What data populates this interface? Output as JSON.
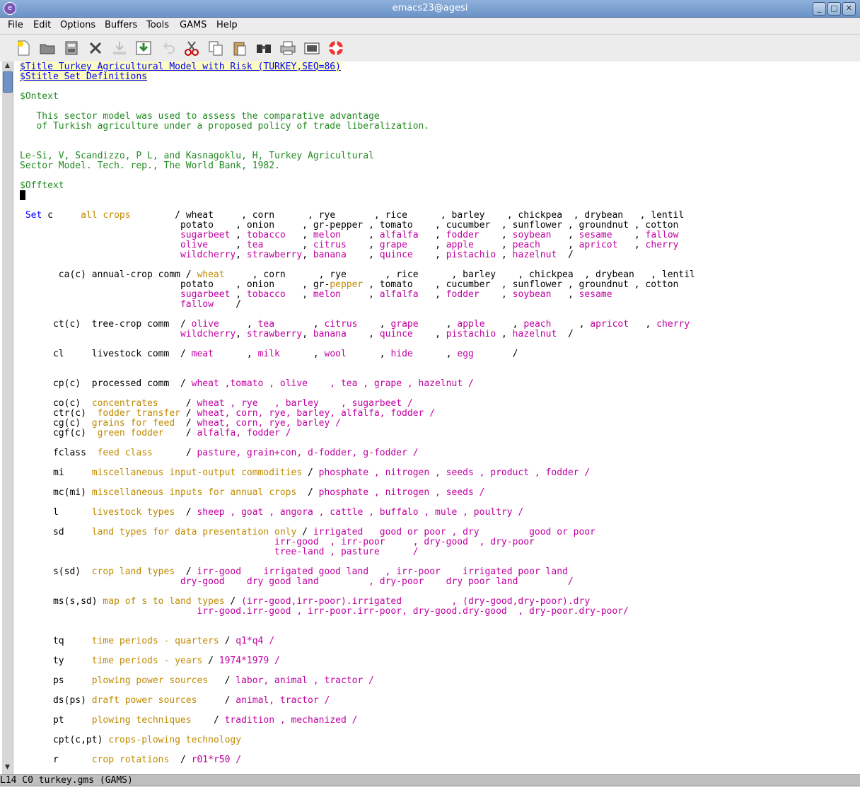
{
  "window": {
    "title": "emacs23@agesi"
  },
  "menu": [
    "File",
    "Edit",
    "Options",
    "Buffers",
    "Tools",
    "GAMS",
    "Help"
  ],
  "toolbar": [
    "new-file",
    "open",
    "dired",
    "close",
    "save",
    "save-as",
    "undo",
    "cut",
    "copy",
    "paste",
    "search",
    "print",
    "preferences",
    "help"
  ],
  "modeline": "L14 C0 turkey.gms (GAMS)",
  "lines": [
    [
      [
        "$Title Turkey Agricultural Model with Risk (TURKEY,SEQ=86)",
        "dir"
      ]
    ],
    [
      [
        "$Stitle Set Definitions",
        "dir"
      ]
    ],
    [],
    [
      [
        "$Ontext",
        "grn"
      ]
    ],
    [],
    [
      [
        "   This sector model was used to assess the comparative advantage",
        "grn"
      ]
    ],
    [
      [
        "   of Turkish agriculture under a proposed policy of trade liberalization.",
        "grn"
      ]
    ],
    [],
    [],
    [
      [
        "Le-Si, V, Scandizzo, P L, and Kasnagoklu, H, Turkey Agricultural",
        "grn"
      ]
    ],
    [
      [
        "Sector Model. Tech. rep., The World Bank, 1982.",
        "grn"
      ]
    ],
    [],
    [
      [
        "$Offtext",
        "grn"
      ]
    ],
    [],
    [],
    [
      [
        " Set",
        "kw"
      ],
      [
        " c     ",
        ""
      ],
      [
        "all crops",
        "org"
      ],
      [
        "        / wheat     , corn      , rye       , rice      , barley    , chickpea  , drybean   , lentil",
        ""
      ]
    ],
    [
      [
        "                             potato    , onion     , gr-pepper , tomato    , cucumber  , sunflower , groundnut , cotton",
        ""
      ]
    ],
    [
      [
        "                             ",
        ""
      ],
      [
        "sugarbeet",
        "mag"
      ],
      [
        " , ",
        ""
      ],
      [
        "tobacco",
        "mag"
      ],
      [
        "   , ",
        ""
      ],
      [
        "melon",
        "mag"
      ],
      [
        "     , ",
        ""
      ],
      [
        "alfalfa",
        "mag"
      ],
      [
        "   , ",
        ""
      ],
      [
        "fodder",
        "mag"
      ],
      [
        "    , ",
        ""
      ],
      [
        "soybean",
        "mag"
      ],
      [
        "   , ",
        ""
      ],
      [
        "sesame",
        "mag"
      ],
      [
        "    , ",
        ""
      ],
      [
        "fallow",
        "mag"
      ]
    ],
    [
      [
        "                             ",
        ""
      ],
      [
        "olive",
        "mag"
      ],
      [
        "     , ",
        ""
      ],
      [
        "tea",
        "mag"
      ],
      [
        "       , ",
        ""
      ],
      [
        "citrus",
        "mag"
      ],
      [
        "    , ",
        ""
      ],
      [
        "grape",
        "mag"
      ],
      [
        "     , ",
        ""
      ],
      [
        "apple",
        "mag"
      ],
      [
        "     , ",
        ""
      ],
      [
        "peach",
        "mag"
      ],
      [
        "     , ",
        ""
      ],
      [
        "apricot",
        "mag"
      ],
      [
        "   , ",
        ""
      ],
      [
        "cherry",
        "mag"
      ]
    ],
    [
      [
        "                             ",
        ""
      ],
      [
        "wildcherry",
        "mag"
      ],
      [
        ", ",
        ""
      ],
      [
        "strawberry",
        "mag"
      ],
      [
        ", ",
        ""
      ],
      [
        "banana",
        "mag"
      ],
      [
        "    , ",
        ""
      ],
      [
        "quince",
        "mag"
      ],
      [
        "    , ",
        ""
      ],
      [
        "pistachio",
        "mag"
      ],
      [
        " , ",
        ""
      ],
      [
        "hazelnut",
        "mag"
      ],
      [
        "  /",
        ""
      ]
    ],
    [],
    [
      [
        "       ca(c) annual-crop comm / ",
        ""
      ],
      [
        "wheat",
        "org"
      ],
      [
        "     , corn      , rye       , rice      , barley    , chickpea  , drybean   , lentil",
        ""
      ]
    ],
    [
      [
        "                             potato    , onion     , gr-",
        ""
      ],
      [
        "pepper",
        "org"
      ],
      [
        " , tomato    , cucumber  , sunflower , groundnut , cotton",
        ""
      ]
    ],
    [
      [
        "                             ",
        ""
      ],
      [
        "sugarbeet",
        "mag"
      ],
      [
        " , ",
        ""
      ],
      [
        "tobacco",
        "mag"
      ],
      [
        "   , ",
        ""
      ],
      [
        "melon",
        "mag"
      ],
      [
        "     , ",
        ""
      ],
      [
        "alfalfa",
        "mag"
      ],
      [
        "   , ",
        ""
      ],
      [
        "fodder",
        "mag"
      ],
      [
        "    , ",
        ""
      ],
      [
        "soybean",
        "mag"
      ],
      [
        "   , ",
        ""
      ],
      [
        "sesame",
        "mag"
      ]
    ],
    [
      [
        "                             ",
        ""
      ],
      [
        "fallow",
        "mag"
      ],
      [
        "    /",
        ""
      ]
    ],
    [],
    [
      [
        "      ct(c)  tree-crop comm  / ",
        ""
      ],
      [
        "olive",
        "mag"
      ],
      [
        "     , ",
        ""
      ],
      [
        "tea",
        "mag"
      ],
      [
        "       , ",
        ""
      ],
      [
        "citrus",
        "mag"
      ],
      [
        "    , ",
        ""
      ],
      [
        "grape",
        "mag"
      ],
      [
        "     , ",
        ""
      ],
      [
        "apple",
        "mag"
      ],
      [
        "     , ",
        ""
      ],
      [
        "peach",
        "mag"
      ],
      [
        "     , ",
        ""
      ],
      [
        "apricot",
        "mag"
      ],
      [
        "   , ",
        ""
      ],
      [
        "cherry",
        "mag"
      ]
    ],
    [
      [
        "                             ",
        ""
      ],
      [
        "wildcherry",
        "mag"
      ],
      [
        ", ",
        ""
      ],
      [
        "strawberry",
        "mag"
      ],
      [
        ", ",
        ""
      ],
      [
        "banana",
        "mag"
      ],
      [
        "    , ",
        ""
      ],
      [
        "quince",
        "mag"
      ],
      [
        "    , ",
        ""
      ],
      [
        "pistachio",
        "mag"
      ],
      [
        " , ",
        ""
      ],
      [
        "hazelnut",
        "mag"
      ],
      [
        "  /",
        ""
      ]
    ],
    [],
    [
      [
        "      cl     livestock comm  / ",
        ""
      ],
      [
        "meat",
        "mag"
      ],
      [
        "      , ",
        ""
      ],
      [
        "milk",
        "mag"
      ],
      [
        "      , ",
        ""
      ],
      [
        "wool",
        "mag"
      ],
      [
        "      , ",
        ""
      ],
      [
        "hide",
        "mag"
      ],
      [
        "      , ",
        ""
      ],
      [
        "egg",
        "mag"
      ],
      [
        "       /",
        ""
      ]
    ],
    [],
    [],
    [
      [
        "      cp(c)  processed comm  / ",
        ""
      ],
      [
        "wheat ,tomato , olive    , tea , grape , hazelnut /",
        "mag"
      ]
    ],
    [],
    [
      [
        "      co(c)  ",
        ""
      ],
      [
        "concentrates",
        "org"
      ],
      [
        "     / ",
        ""
      ],
      [
        "wheat , rye   , barley    , sugarbeet /",
        "mag"
      ]
    ],
    [
      [
        "      ctr(c)  ",
        ""
      ],
      [
        "fodder transfer",
        "org"
      ],
      [
        " / ",
        ""
      ],
      [
        "wheat, corn, rye, barley, alfalfa, fodder /",
        "mag"
      ]
    ],
    [
      [
        "      cg(c)  ",
        ""
      ],
      [
        "grains for feed",
        "org"
      ],
      [
        "  / ",
        ""
      ],
      [
        "wheat, corn, rye, barley /",
        "mag"
      ]
    ],
    [
      [
        "      cgf(c)  ",
        ""
      ],
      [
        "green fodder",
        "org"
      ],
      [
        "    / ",
        ""
      ],
      [
        "alfalfa, fodder /",
        "mag"
      ]
    ],
    [],
    [
      [
        "      fclass  ",
        ""
      ],
      [
        "feed class",
        "org"
      ],
      [
        "      / ",
        ""
      ],
      [
        "pasture, grain+con, d-fodder, g-fodder /",
        "mag"
      ]
    ],
    [],
    [
      [
        "      mi     ",
        ""
      ],
      [
        "miscellaneous input-output commodities",
        "org"
      ],
      [
        " / ",
        ""
      ],
      [
        "phosphate , nitrogen , seeds , product , fodder /",
        "mag"
      ]
    ],
    [],
    [
      [
        "      mc(mi) ",
        ""
      ],
      [
        "miscellaneous inputs for annual crops",
        "org"
      ],
      [
        "  / ",
        ""
      ],
      [
        "phosphate , nitrogen , seeds /",
        "mag"
      ]
    ],
    [],
    [
      [
        "      l      ",
        ""
      ],
      [
        "livestock types",
        "org"
      ],
      [
        "  / ",
        ""
      ],
      [
        "sheep , goat , angora , cattle , buffalo , mule , poultry /",
        "mag"
      ]
    ],
    [],
    [
      [
        "      sd     ",
        ""
      ],
      [
        "land types for data presentation only",
        "org"
      ],
      [
        " / ",
        ""
      ],
      [
        "irrigated   good or poor , dry         good or poor",
        "mag"
      ]
    ],
    [
      [
        "                                              ",
        ""
      ],
      [
        "irr-good  , irr-poor     , dry-good  , dry-poor",
        "mag"
      ]
    ],
    [
      [
        "                                              ",
        ""
      ],
      [
        "tree-land , pasture      /",
        "mag"
      ]
    ],
    [],
    [
      [
        "      s(sd)  ",
        ""
      ],
      [
        "crop land types",
        "org"
      ],
      [
        "  / ",
        ""
      ],
      [
        "irr-good    irrigated good land   , irr-poor    irrigated poor land",
        "mag"
      ]
    ],
    [
      [
        "                             ",
        ""
      ],
      [
        "dry-good    dry good land         , dry-poor    dry poor land         /",
        "mag"
      ]
    ],
    [],
    [
      [
        "      ms(s,sd) ",
        ""
      ],
      [
        "map of s to land types",
        "org"
      ],
      [
        " / ",
        ""
      ],
      [
        "(irr-good,irr-poor).irrigated         , (dry-good,dry-poor).dry",
        "mag"
      ]
    ],
    [
      [
        "                                ",
        ""
      ],
      [
        "irr-good.irr-good , irr-poor.irr-poor, dry-good.dry-good  , dry-poor.dry-poor/",
        "mag"
      ]
    ],
    [],
    [],
    [
      [
        "      tq     ",
        ""
      ],
      [
        "time periods - quarters",
        "org"
      ],
      [
        " / ",
        ""
      ],
      [
        "q1*q4 /",
        "mag"
      ]
    ],
    [],
    [
      [
        "      ty     ",
        ""
      ],
      [
        "time periods - years",
        "org"
      ],
      [
        " / ",
        ""
      ],
      [
        "1974*1979 /",
        "mag"
      ]
    ],
    [],
    [
      [
        "      ps     ",
        ""
      ],
      [
        "plowing power sources",
        "org"
      ],
      [
        "   / ",
        ""
      ],
      [
        "labor, animal , tractor /",
        "mag"
      ]
    ],
    [],
    [
      [
        "      ds(ps) ",
        ""
      ],
      [
        "draft power sources",
        "org"
      ],
      [
        "     / ",
        ""
      ],
      [
        "animal, tractor /",
        "mag"
      ]
    ],
    [],
    [
      [
        "      pt     ",
        ""
      ],
      [
        "plowing techniques",
        "org"
      ],
      [
        "    / ",
        ""
      ],
      [
        "tradition , mechanized /",
        "mag"
      ]
    ],
    [],
    [
      [
        "      cpt(c,pt) ",
        ""
      ],
      [
        "crops-plowing technology",
        "org"
      ]
    ],
    [],
    [
      [
        "      r      ",
        ""
      ],
      [
        "crop rotations",
        "org"
      ],
      [
        "  / ",
        ""
      ],
      [
        "r01*r50 /",
        "mag"
      ]
    ]
  ]
}
